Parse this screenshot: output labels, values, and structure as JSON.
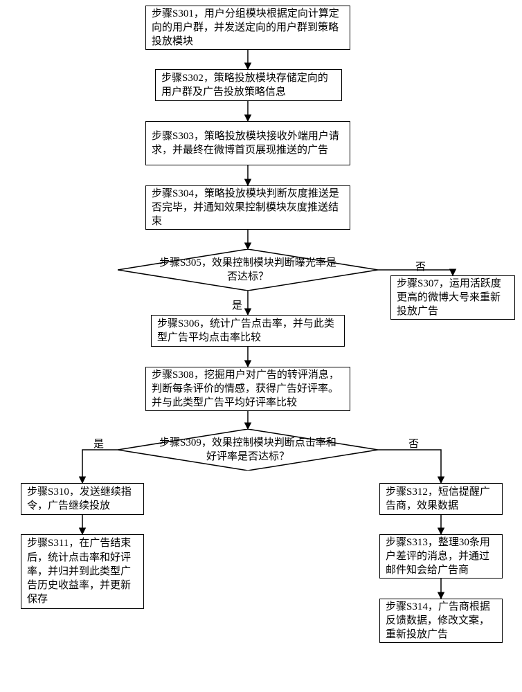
{
  "nodes": {
    "s301": "步骤S301，用户分组模块根据定向计算定向的用户群，并发送定向的用户群到策略投放模块",
    "s302": "步骤S302，策略投放模块存储定向的用户群及广告投放策略信息",
    "s303": "步骤S303，策略投放模块接收外端用户请求，并最终在微博首页展现推送的广告",
    "s304": "步骤S304，策略投放模块判断灰度推送是否完毕，并通知效果控制模块灰度推送结束",
    "s305": "步骤S305，效果控制模块判断曝光率是否达标？",
    "s306": "步骤S306，统计广告点击率，并与此类型广告平均点击率比较",
    "s307": "步骤S307，运用活跃度更高的微博大号来重新投放广告",
    "s308": "步骤S308，挖掘用户对广告的转评消息，判断每条评价的情感，获得广告好评率。并与此类型广告平均好评率比较",
    "s309": "步骤S309，效果控制模块判断点击率和好评率是否达标？",
    "s310": "步骤S310，发送继续指令，广告继续投放",
    "s311": "步骤S311，在广告结束后，统计点击率和好评率，并归并到此类型广告历史收益率，并更新保存",
    "s312": "步骤S312，短信提醒广告商，效果数据",
    "s313": "步骤S313，整理30条用户差评的消息，并通过邮件知会给广告商",
    "s314": "步骤S314，广告商根据反馈数据，修改文案，重新投放广告"
  },
  "labels": {
    "yes": "是",
    "no": "否"
  },
  "chart_data": {
    "type": "flowchart",
    "nodes": [
      {
        "id": "S301",
        "shape": "process",
        "text": "步骤S301，用户分组模块根据定向计算定向的用户群，并发送定向的用户群到策略投放模块"
      },
      {
        "id": "S302",
        "shape": "process",
        "text": "步骤S302，策略投放模块存储定向的用户群及广告投放策略信息"
      },
      {
        "id": "S303",
        "shape": "process",
        "text": "步骤S303，策略投放模块接收外端用户请求，并最终在微博首页展现推送的广告"
      },
      {
        "id": "S304",
        "shape": "process",
        "text": "步骤S304，策略投放模块判断灰度推送是否完毕，并通知效果控制模块灰度推送结束"
      },
      {
        "id": "S305",
        "shape": "decision",
        "text": "步骤S305，效果控制模块判断曝光率是否达标？"
      },
      {
        "id": "S306",
        "shape": "process",
        "text": "步骤S306，统计广告点击率，并与此类型广告平均点击率比较"
      },
      {
        "id": "S307",
        "shape": "process",
        "text": "步骤S307，运用活跃度更高的微博大号来重新投放广告"
      },
      {
        "id": "S308",
        "shape": "process",
        "text": "步骤S308，挖掘用户对广告的转评消息，判断每条评价的情感，获得广告好评率。并与此类型广告平均好评率比较"
      },
      {
        "id": "S309",
        "shape": "decision",
        "text": "步骤S309，效果控制模块判断点击率和好评率是否达标？"
      },
      {
        "id": "S310",
        "shape": "process",
        "text": "步骤S310，发送继续指令，广告继续投放"
      },
      {
        "id": "S311",
        "shape": "process",
        "text": "步骤S311，在广告结束后，统计点击率和好评率，并归并到此类型广告历史收益率，并更新保存"
      },
      {
        "id": "S312",
        "shape": "process",
        "text": "步骤S312，短信提醒广告商，效果数据"
      },
      {
        "id": "S313",
        "shape": "process",
        "text": "步骤S313，整理30条用户差评的消息，并通过邮件知会给广告商"
      },
      {
        "id": "S314",
        "shape": "process",
        "text": "步骤S314，广告商根据反馈数据，修改文案，重新投放广告"
      }
    ],
    "edges": [
      {
        "from": "S301",
        "to": "S302"
      },
      {
        "from": "S302",
        "to": "S303"
      },
      {
        "from": "S303",
        "to": "S304"
      },
      {
        "from": "S304",
        "to": "S305"
      },
      {
        "from": "S305",
        "to": "S306",
        "label": "是"
      },
      {
        "from": "S305",
        "to": "S307",
        "label": "否"
      },
      {
        "from": "S306",
        "to": "S308"
      },
      {
        "from": "S308",
        "to": "S309"
      },
      {
        "from": "S309",
        "to": "S310",
        "label": "是"
      },
      {
        "from": "S309",
        "to": "S312",
        "label": "否"
      },
      {
        "from": "S310",
        "to": "S311"
      },
      {
        "from": "S312",
        "to": "S313"
      },
      {
        "from": "S313",
        "to": "S314"
      }
    ]
  }
}
